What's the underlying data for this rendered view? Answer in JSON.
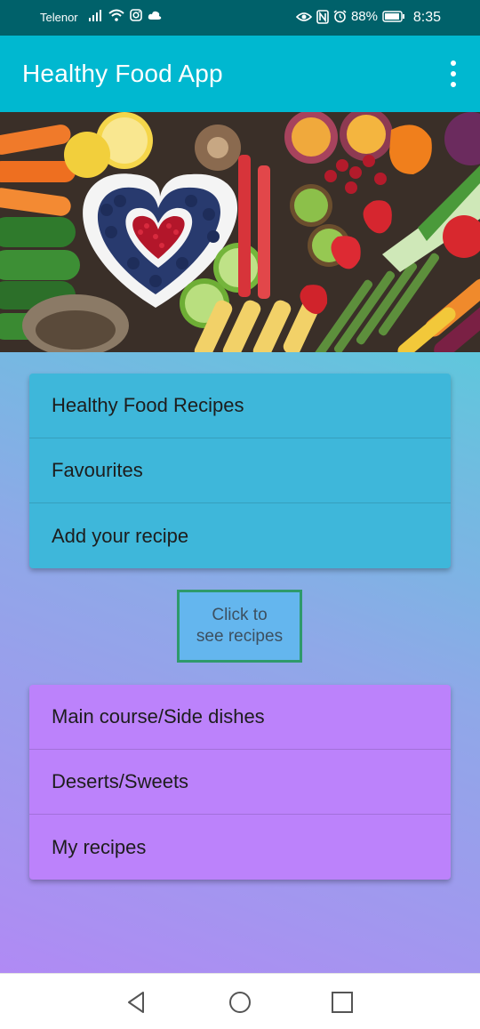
{
  "status_bar": {
    "carrier": "Telenor",
    "battery": "88%",
    "time": "8:35"
  },
  "app_bar": {
    "title": "Healthy Food App"
  },
  "menu_top": {
    "items": [
      "Healthy Food Recipes",
      "Favourites",
      "Add your recipe"
    ]
  },
  "recipes_button": {
    "line1": "Click to",
    "line2": "see recipes"
  },
  "menu_bottom": {
    "items": [
      "Main course/Side dishes",
      "Deserts/Sweets",
      "My recipes"
    ]
  },
  "colors": {
    "status_bar": "#00616a",
    "app_bar": "#00b8d0",
    "card_top": "#3eb7da",
    "card_bottom": "#bc82fb",
    "button_border": "#2e9a6b"
  }
}
